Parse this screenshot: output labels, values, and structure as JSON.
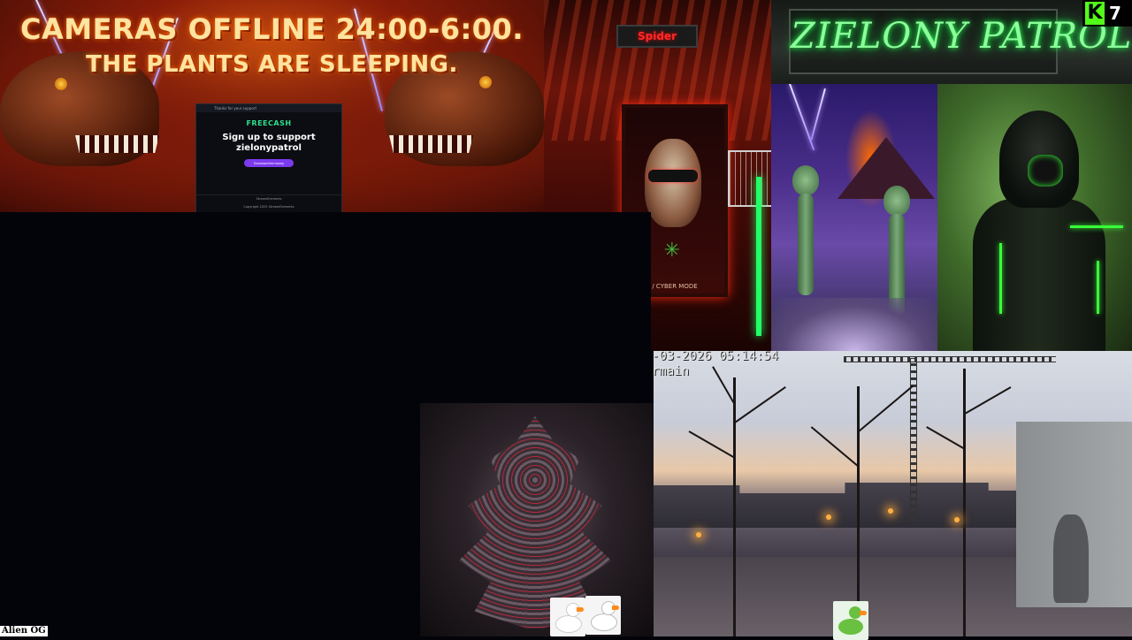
{
  "banner": {
    "line1": "CAMERAS OFFLINE 24:00-6:00.",
    "line2": "THE PLANTS ARE SLEEPING."
  },
  "freecash": {
    "topbar_text": "Thanks for your support",
    "logo": "FREECASH",
    "heading_line1": "Sign up to support",
    "heading_line2": "zielonypatrol",
    "button_label": "Download free money",
    "footer_line1": "StreamElements",
    "footer_line2": "Copyright 2025 StreamElements",
    "accent_color": "#7c3aed",
    "logo_color": "#2ee08b"
  },
  "room": {
    "sign_text": "Spider",
    "poster_caption": "/ CYBER MODE",
    "leaf_icon": "cannabis-leaf-icon"
  },
  "zsign": {
    "text": "ZIELONY PATROL",
    "neon_color": "#2bff55"
  },
  "kick": {
    "logo_letter": "K",
    "viewer_count": "7",
    "brand_color": "#53fc18"
  },
  "camera": {
    "timestamp": "-03-2026 05:14:54",
    "location": "rmain"
  },
  "overlay_label": "Alien OG"
}
